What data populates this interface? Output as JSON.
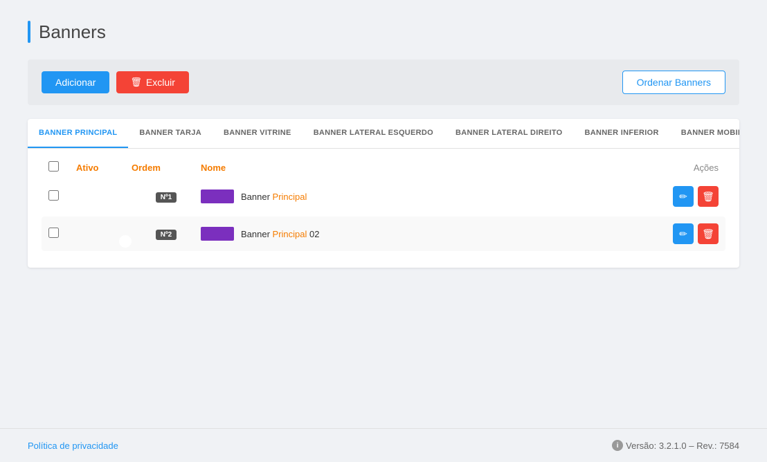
{
  "page": {
    "title": "Banners"
  },
  "toolbar": {
    "add_label": "Adicionar",
    "delete_label": "Excluir",
    "order_label": "Ordenar Banners"
  },
  "tabs": [
    {
      "id": "principal",
      "label": "BANNER PRINCIPAL",
      "active": true
    },
    {
      "id": "tarja",
      "label": "BANNER TARJA",
      "active": false
    },
    {
      "id": "vitrine",
      "label": "BANNER VITRINE",
      "active": false
    },
    {
      "id": "lateral-esquerdo",
      "label": "BANNER LATERAL ESQUERDO",
      "active": false
    },
    {
      "id": "lateral-direito",
      "label": "BANNER LATERAL DIREITO",
      "active": false
    },
    {
      "id": "inferior",
      "label": "BANNER INFERIOR",
      "active": false
    },
    {
      "id": "mobile",
      "label": "BANNER MOBILE",
      "active": false
    }
  ],
  "table": {
    "columns": {
      "ativo": "Ativo",
      "ordem": "Ordem",
      "nome": "Nome",
      "acoes": "Ações"
    },
    "rows": [
      {
        "active": true,
        "badge": "Nº1",
        "name_plain": "Banner Principal",
        "name_highlighted": "Principal",
        "name_full": "Banner Principal"
      },
      {
        "active": true,
        "badge": "Nº2",
        "name_plain": "Banner Principal 02",
        "name_highlighted": "Principal",
        "name_full": "Banner Principal 02"
      }
    ]
  },
  "footer": {
    "privacy_link": "Política de privacidade",
    "version": "Versão: 3.2.1.0 – Rev.: 7584"
  }
}
